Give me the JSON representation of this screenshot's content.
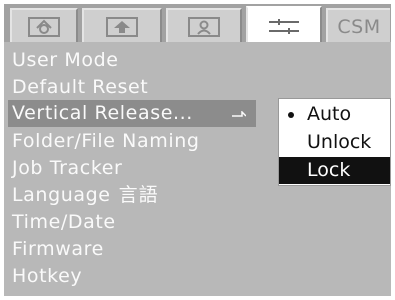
{
  "tabs": [
    {
      "id": "camera",
      "icon": "camera-icon",
      "label": ""
    },
    {
      "id": "playback",
      "icon": "playback-icon",
      "label": ""
    },
    {
      "id": "user",
      "icon": "person-icon",
      "label": ""
    },
    {
      "id": "setup",
      "icon": "wrench-settings-icon",
      "label": ""
    },
    {
      "id": "csm",
      "icon": "",
      "label": "CSM"
    }
  ],
  "active_tab": "setup",
  "menu": {
    "items": [
      {
        "label": "User Mode"
      },
      {
        "label": "Default Reset"
      },
      {
        "label": "Vertical Release...",
        "selected": true
      },
      {
        "label": "Folder/File Naming"
      },
      {
        "label": "Job Tracker"
      },
      {
        "label": "Language",
        "extra": "言語"
      },
      {
        "label": "Time/Date"
      },
      {
        "label": "Firmware"
      },
      {
        "label": "Hotkey"
      }
    ]
  },
  "popup": {
    "options": [
      {
        "label": "Auto",
        "current": true
      },
      {
        "label": "Unlock"
      },
      {
        "label": "Lock",
        "highlighted": true
      }
    ]
  },
  "colors": {
    "panel": "#b8b8b8",
    "menu_text": "#fafafa",
    "selected_bg": "#8c8c8c",
    "popup_highlight": "#111111"
  }
}
